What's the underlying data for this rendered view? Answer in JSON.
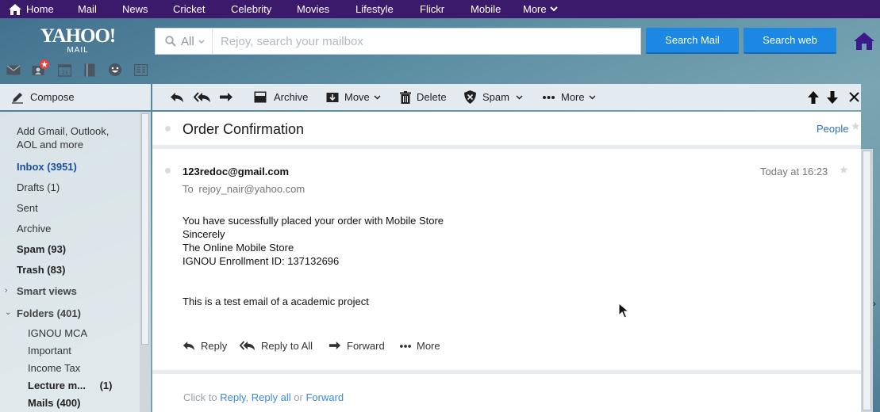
{
  "topnav": {
    "items": [
      "Home",
      "Mail",
      "News",
      "Cricket",
      "Celebrity",
      "Movies",
      "Lifestyle",
      "Flickr",
      "Mobile",
      "More"
    ]
  },
  "header": {
    "logo_top": "YAHOO!",
    "logo_bottom": "MAIL",
    "search_scope": "All",
    "search_placeholder": "Rejoy, search your mailbox",
    "search_mail_label": "Search Mail",
    "search_web_label": "Search web"
  },
  "compose_label": "Compose",
  "sidebar": {
    "add_accounts": "Add Gmail, Outlook,",
    "add_accounts_2": "AOL and more",
    "inbox": "Inbox (3951)",
    "drafts": "Drafts",
    "drafts_count": "(1)",
    "sent": "Sent",
    "archive": "Archive",
    "spam": "Spam (93)",
    "trash": "Trash (83)",
    "smart_views": "Smart views",
    "folders": "Folders (401)",
    "folder_items": [
      "IGNOU MCA",
      "Important",
      "Income Tax",
      "Lecture m...",
      "Mails (400)"
    ],
    "lecture_count": "(1)"
  },
  "toolbar": {
    "archive": "Archive",
    "move": "Move",
    "delete": "Delete",
    "spam": "Spam",
    "more": "More"
  },
  "message": {
    "subject": "Order Confirmation",
    "people_link": "People",
    "from": "123redoc@gmail.com",
    "to_label": "To",
    "to": "rejoy_nair@yahoo.com",
    "time": "Today at 16:23",
    "body": [
      "You have sucessfully placed your order with Mobile Store",
      "Sincerely",
      "The Online Mobile Store",
      "IGNOU Enrollment ID: 137132696",
      "This is a test email of a academic project"
    ],
    "actions": {
      "reply": "Reply",
      "reply_all": "Reply to All",
      "forward": "Forward",
      "more": "More"
    }
  },
  "quick_reply": {
    "prefix": "Click to",
    "reply": "Reply",
    "reply_all": "Reply all",
    "or": "or",
    "forward": "Forward"
  },
  "colors": {
    "topbar": "#3c1a6b",
    "accent_blue": "#1d88e3",
    "link": "#3b8ad9",
    "inbox_blue": "#1b4f9c"
  }
}
